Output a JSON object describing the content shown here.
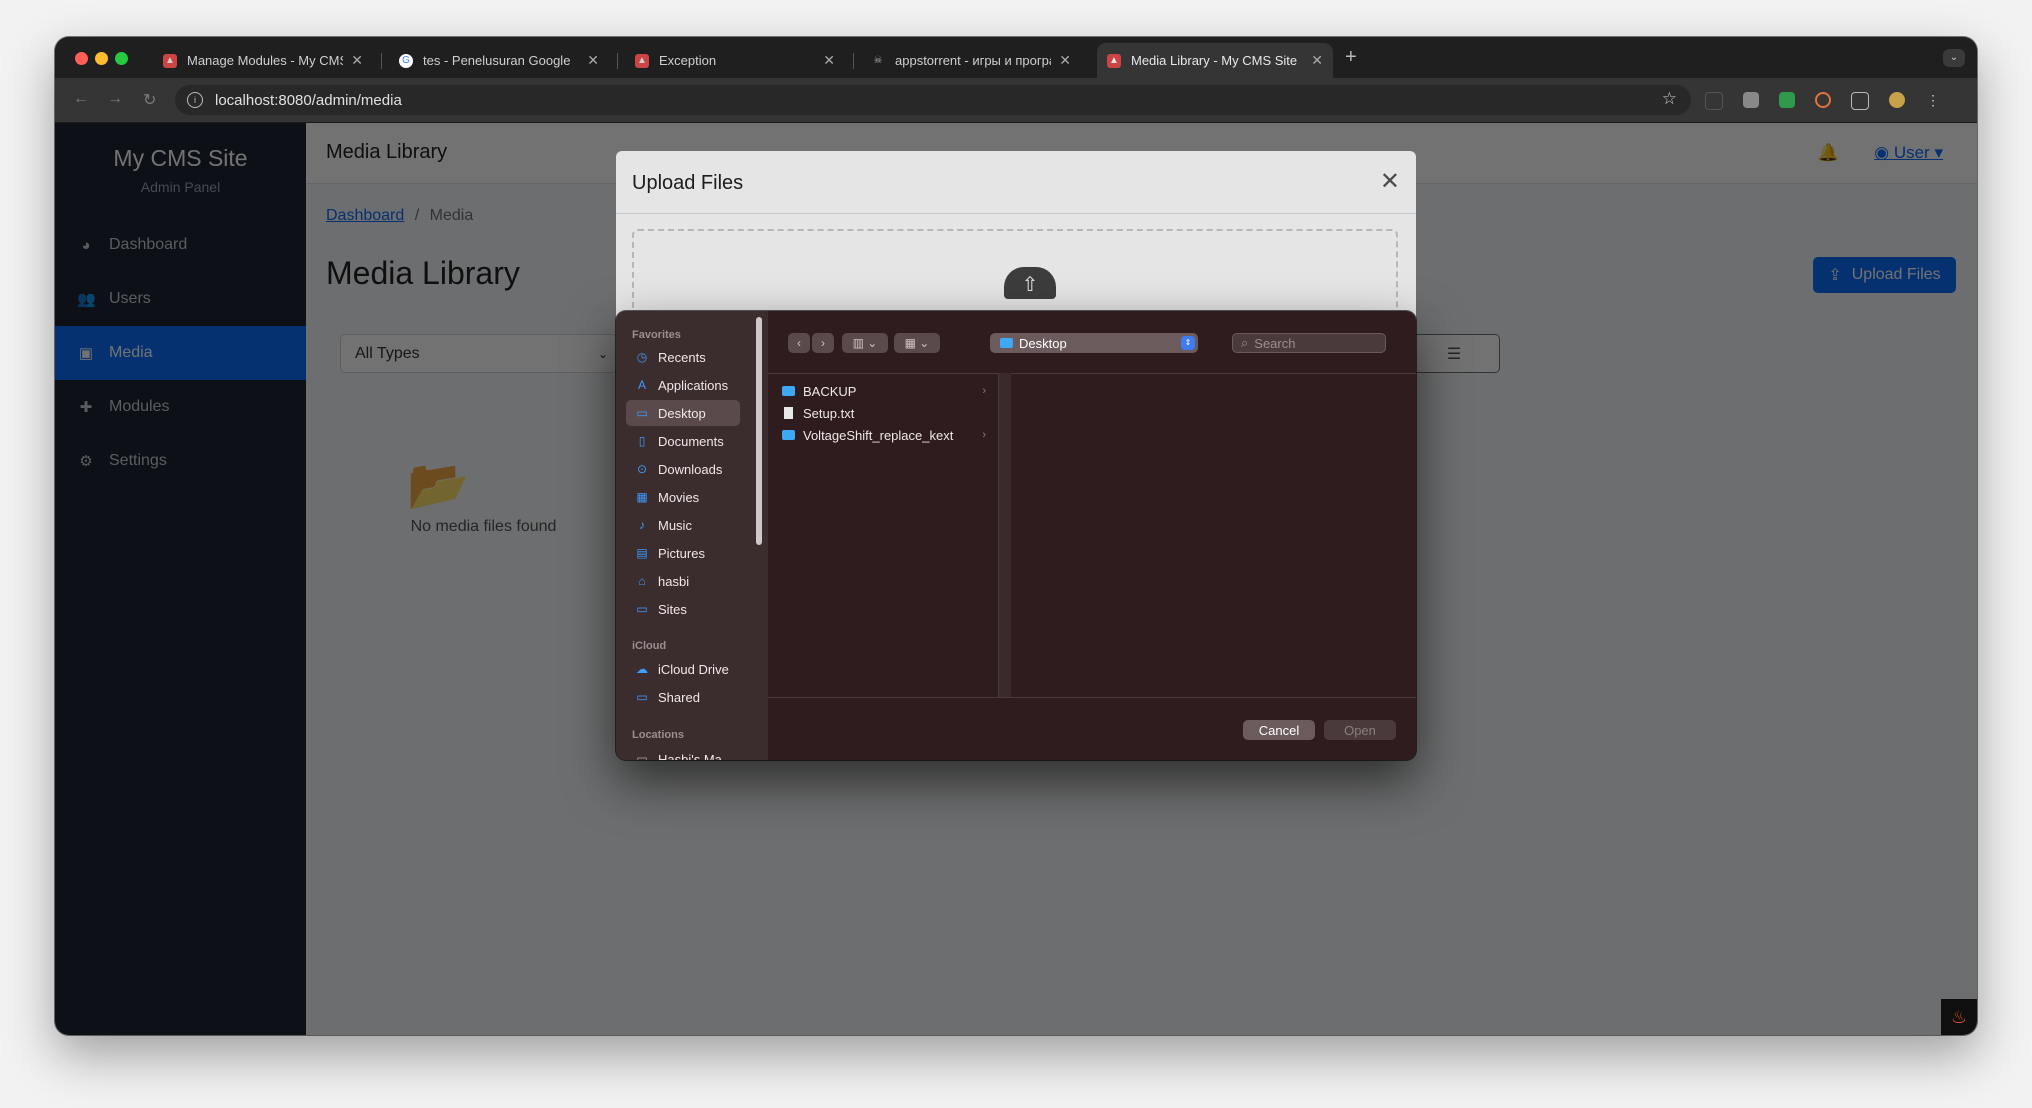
{
  "browser": {
    "tabs": [
      {
        "title": "Manage Modules - My CMS S",
        "active": false
      },
      {
        "title": "tes - Penelusuran Google",
        "active": false
      },
      {
        "title": "Exception",
        "active": false
      },
      {
        "title": "appstorrent - игры и програ",
        "active": false
      },
      {
        "title": "Media Library - My CMS Site",
        "active": true
      }
    ],
    "new_tab": "+",
    "url": "localhost:8080/admin/media"
  },
  "sidebar": {
    "brand": "My CMS Site",
    "subtitle": "Admin Panel",
    "items": [
      {
        "label": "Dashboard",
        "icon": "gauge-icon"
      },
      {
        "label": "Users",
        "icon": "users-icon"
      },
      {
        "label": "Media",
        "icon": "images-icon",
        "active": true
      },
      {
        "label": "Modules",
        "icon": "puzzle-icon"
      },
      {
        "label": "Settings",
        "icon": "gear-icon"
      }
    ]
  },
  "header": {
    "title": "Media Library",
    "user": "User"
  },
  "breadcrumb": {
    "home": "Dashboard",
    "separator": "/",
    "current": "Media"
  },
  "main": {
    "title": "Media Library",
    "upload_label": "Upload Files",
    "filter_value": "All Types",
    "empty_text": "No media files found"
  },
  "modal": {
    "title": "Upload Files"
  },
  "file_dialog": {
    "sections": {
      "favorites": "Favorites",
      "icloud": "iCloud",
      "locations": "Locations"
    },
    "favorites": [
      "Recents",
      "Applications",
      "Desktop",
      "Documents",
      "Downloads",
      "Movies",
      "Music",
      "Pictures",
      "hasbi",
      "Sites"
    ],
    "selected": "Desktop",
    "icloud": [
      "iCloud Drive",
      "Shared"
    ],
    "locations": [
      "Hasbi's Ma"
    ],
    "location": "Desktop",
    "search_placeholder": "Search",
    "files": [
      {
        "name": "BACKUP",
        "type": "folder"
      },
      {
        "name": "Setup.txt",
        "type": "file"
      },
      {
        "name": "VoltageShift_replace_kext",
        "type": "folder"
      }
    ],
    "cancel_label": "Cancel",
    "open_label": "Open"
  },
  "colors": {
    "accent": "#0d6efd",
    "sidebar": "#1e2735",
    "folder": "#3da9f5"
  }
}
